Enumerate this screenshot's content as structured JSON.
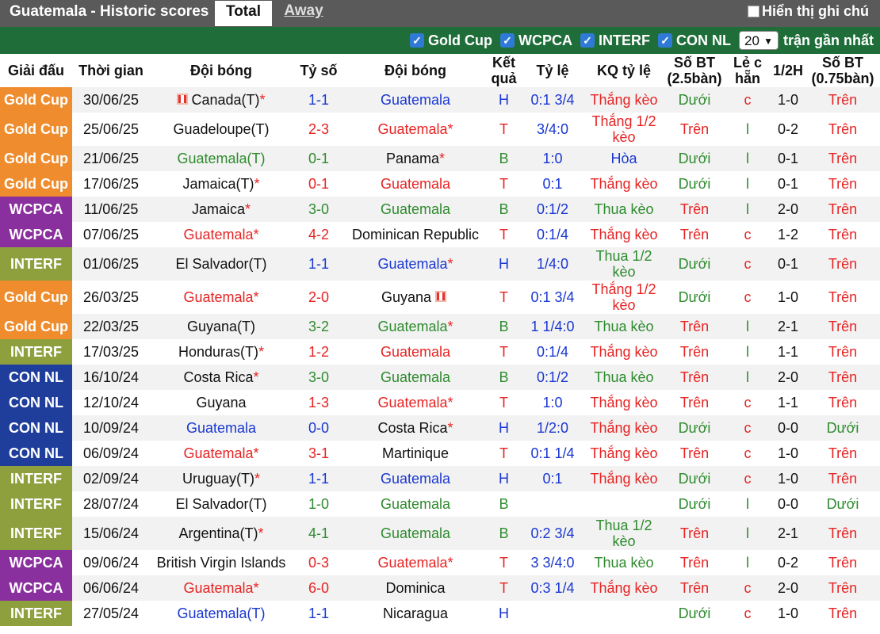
{
  "header": {
    "title": "Guatemala - Historic scores",
    "tabs": [
      "Total",
      "Away"
    ],
    "notes_label": "Hiển thị ghi chú"
  },
  "filters": {
    "checkboxes": [
      "Gold Cup",
      "WCPCA",
      "INTERF",
      "CON NL"
    ],
    "count_value": "20",
    "count_label": "trận gần nhất"
  },
  "columns": [
    "Giải đấu",
    "Thời gian",
    "Đội bóng",
    "Tỷ số",
    "Đội bóng",
    "Kết quả",
    "Tỷ lệ",
    "KQ tỷ lệ",
    "Số BT (2.5bàn)",
    "Lẻ c hẵn",
    "1/2H",
    "Số BT (0.75bàn)"
  ],
  "league_colors": {
    "Gold Cup": "#ef8d2e",
    "WCPCA": "#8a2f9e",
    "INTERF": "#8e9f3e",
    "CON NL": "#1f3e9c"
  },
  "text_colors": {
    "green": "#2e8b2e",
    "red": "#e62424",
    "blue": "#1a37d1"
  },
  "rows": [
    {
      "league": "Gold Cup",
      "date": "30/06/25",
      "home": "Canada(T)",
      "home_star": "*",
      "home_flag": true,
      "home_color": "black",
      "score_home": "1",
      "score_away": "1",
      "score_color": "blue",
      "away": "Guatemala",
      "away_star": "",
      "away_flag": false,
      "away_color": "blue",
      "result": "H",
      "result_color": "blue",
      "odds": "0:1 3/4",
      "odds_result": "Thắng kèo",
      "odds_result_color": "red",
      "ou": "Dưới",
      "ou_color": "green",
      "oe": "c",
      "oe_color": "red",
      "half": "1-0",
      "ou2": "Trên",
      "ou2_color": "red",
      "tall": false
    },
    {
      "league": "Gold Cup",
      "date": "25/06/25",
      "home": "Guadeloupe(T)",
      "home_star": "",
      "home_flag": false,
      "home_color": "black",
      "score_home": "2",
      "score_away": "3",
      "score_color": "red",
      "away": "Guatemala",
      "away_star": "*",
      "away_flag": false,
      "away_color": "red",
      "result": "T",
      "result_color": "red",
      "odds": "3/4:0",
      "odds_result": "Thắng 1/2 kèo",
      "odds_result_color": "red",
      "ou": "Trên",
      "ou_color": "red",
      "oe": "l",
      "oe_color": "green",
      "half": "0-2",
      "ou2": "Trên",
      "ou2_color": "red",
      "tall": true
    },
    {
      "league": "Gold Cup",
      "date": "21/06/25",
      "home": "Guatemala(T)",
      "home_star": "",
      "home_flag": false,
      "home_color": "green",
      "score_home": "0",
      "score_away": "1",
      "score_color": "green",
      "away": "Panama",
      "away_star": "*",
      "away_flag": false,
      "away_color": "black",
      "result": "B",
      "result_color": "green",
      "odds": "1:0",
      "odds_result": "Hòa",
      "odds_result_color": "blue",
      "ou": "Dưới",
      "ou_color": "green",
      "oe": "l",
      "oe_color": "green",
      "half": "0-1",
      "ou2": "Trên",
      "ou2_color": "red",
      "tall": false
    },
    {
      "league": "Gold Cup",
      "date": "17/06/25",
      "home": "Jamaica(T)",
      "home_star": "*",
      "home_flag": false,
      "home_color": "black",
      "score_home": "0",
      "score_away": "1",
      "score_color": "red",
      "away": "Guatemala",
      "away_star": "",
      "away_flag": false,
      "away_color": "red",
      "result": "T",
      "result_color": "red",
      "odds": "0:1",
      "odds_result": "Thắng kèo",
      "odds_result_color": "red",
      "ou": "Dưới",
      "ou_color": "green",
      "oe": "l",
      "oe_color": "green",
      "half": "0-1",
      "ou2": "Trên",
      "ou2_color": "red",
      "tall": false
    },
    {
      "league": "WCPCA",
      "date": "11/06/25",
      "home": "Jamaica",
      "home_star": "*",
      "home_flag": false,
      "home_color": "black",
      "score_home": "3",
      "score_away": "0",
      "score_color": "green",
      "away": "Guatemala",
      "away_star": "",
      "away_flag": false,
      "away_color": "green",
      "result": "B",
      "result_color": "green",
      "odds": "0:1/2",
      "odds_result": "Thua kèo",
      "odds_result_color": "green",
      "ou": "Trên",
      "ou_color": "red",
      "oe": "l",
      "oe_color": "green",
      "half": "2-0",
      "ou2": "Trên",
      "ou2_color": "red",
      "tall": false
    },
    {
      "league": "WCPCA",
      "date": "07/06/25",
      "home": "Guatemala",
      "home_star": "*",
      "home_flag": false,
      "home_color": "red",
      "score_home": "4",
      "score_away": "2",
      "score_color": "red",
      "away": "Dominican Republic",
      "away_star": "",
      "away_flag": false,
      "away_color": "black",
      "result": "T",
      "result_color": "red",
      "odds": "0:1/4",
      "odds_result": "Thắng kèo",
      "odds_result_color": "red",
      "ou": "Trên",
      "ou_color": "red",
      "oe": "c",
      "oe_color": "red",
      "half": "1-2",
      "ou2": "Trên",
      "ou2_color": "red",
      "tall": false
    },
    {
      "league": "INTERF",
      "date": "01/06/25",
      "home": "El Salvador(T)",
      "home_star": "",
      "home_flag": false,
      "home_color": "black",
      "score_home": "1",
      "score_away": "1",
      "score_color": "blue",
      "away": "Guatemala",
      "away_star": "*",
      "away_flag": false,
      "away_color": "blue",
      "result": "H",
      "result_color": "blue",
      "odds": "1/4:0",
      "odds_result": "Thua 1/2 kèo",
      "odds_result_color": "green",
      "ou": "Dưới",
      "ou_color": "green",
      "oe": "c",
      "oe_color": "red",
      "half": "0-1",
      "ou2": "Trên",
      "ou2_color": "red",
      "tall": true
    },
    {
      "league": "Gold Cup",
      "date": "26/03/25",
      "home": "Guatemala",
      "home_star": "*",
      "home_flag": false,
      "home_color": "red",
      "score_home": "2",
      "score_away": "0",
      "score_color": "red",
      "away": "Guyana",
      "away_star": "",
      "away_flag": true,
      "away_color": "black",
      "result": "T",
      "result_color": "red",
      "odds": "0:1 3/4",
      "odds_result": "Thắng 1/2 kèo",
      "odds_result_color": "red",
      "ou": "Dưới",
      "ou_color": "green",
      "oe": "c",
      "oe_color": "red",
      "half": "1-0",
      "ou2": "Trên",
      "ou2_color": "red",
      "tall": true
    },
    {
      "league": "Gold Cup",
      "date": "22/03/25",
      "home": "Guyana(T)",
      "home_star": "",
      "home_flag": false,
      "home_color": "black",
      "score_home": "3",
      "score_away": "2",
      "score_color": "green",
      "away": "Guatemala",
      "away_star": "*",
      "away_flag": false,
      "away_color": "green",
      "result": "B",
      "result_color": "green",
      "odds": "1 1/4:0",
      "odds_result": "Thua kèo",
      "odds_result_color": "green",
      "ou": "Trên",
      "ou_color": "red",
      "oe": "l",
      "oe_color": "green",
      "half": "2-1",
      "ou2": "Trên",
      "ou2_color": "red",
      "tall": false
    },
    {
      "league": "INTERF",
      "date": "17/03/25",
      "home": "Honduras(T)",
      "home_star": "*",
      "home_flag": false,
      "home_color": "black",
      "score_home": "1",
      "score_away": "2",
      "score_color": "red",
      "away": "Guatemala",
      "away_star": "",
      "away_flag": false,
      "away_color": "red",
      "result": "T",
      "result_color": "red",
      "odds": "0:1/4",
      "odds_result": "Thắng kèo",
      "odds_result_color": "red",
      "ou": "Trên",
      "ou_color": "red",
      "oe": "l",
      "oe_color": "green",
      "half": "1-1",
      "ou2": "Trên",
      "ou2_color": "red",
      "tall": false
    },
    {
      "league": "CON NL",
      "date": "16/10/24",
      "home": "Costa Rica",
      "home_star": "*",
      "home_flag": false,
      "home_color": "black",
      "score_home": "3",
      "score_away": "0",
      "score_color": "green",
      "away": "Guatemala",
      "away_star": "",
      "away_flag": false,
      "away_color": "green",
      "result": "B",
      "result_color": "green",
      "odds": "0:1/2",
      "odds_result": "Thua kèo",
      "odds_result_color": "green",
      "ou": "Trên",
      "ou_color": "red",
      "oe": "l",
      "oe_color": "green",
      "half": "2-0",
      "ou2": "Trên",
      "ou2_color": "red",
      "tall": false
    },
    {
      "league": "CON NL",
      "date": "12/10/24",
      "home": "Guyana",
      "home_star": "",
      "home_flag": false,
      "home_color": "black",
      "score_home": "1",
      "score_away": "3",
      "score_color": "red",
      "away": "Guatemala",
      "away_star": "*",
      "away_flag": false,
      "away_color": "red",
      "result": "T",
      "result_color": "red",
      "odds": "1:0",
      "odds_result": "Thắng kèo",
      "odds_result_color": "red",
      "ou": "Trên",
      "ou_color": "red",
      "oe": "c",
      "oe_color": "red",
      "half": "1-1",
      "ou2": "Trên",
      "ou2_color": "red",
      "tall": false
    },
    {
      "league": "CON NL",
      "date": "10/09/24",
      "home": "Guatemala",
      "home_star": "",
      "home_flag": false,
      "home_color": "blue",
      "score_home": "0",
      "score_away": "0",
      "score_color": "blue",
      "away": "Costa Rica",
      "away_star": "*",
      "away_flag": false,
      "away_color": "black",
      "result": "H",
      "result_color": "blue",
      "odds": "1/2:0",
      "odds_result": "Thắng kèo",
      "odds_result_color": "red",
      "ou": "Dưới",
      "ou_color": "green",
      "oe": "c",
      "oe_color": "red",
      "half": "0-0",
      "ou2": "Dưới",
      "ou2_color": "green",
      "tall": false
    },
    {
      "league": "CON NL",
      "date": "06/09/24",
      "home": "Guatemala",
      "home_star": "*",
      "home_flag": false,
      "home_color": "red",
      "score_home": "3",
      "score_away": "1",
      "score_color": "red",
      "away": "Martinique",
      "away_star": "",
      "away_flag": false,
      "away_color": "black",
      "result": "T",
      "result_color": "red",
      "odds": "0:1 1/4",
      "odds_result": "Thắng kèo",
      "odds_result_color": "red",
      "ou": "Trên",
      "ou_color": "red",
      "oe": "c",
      "oe_color": "red",
      "half": "1-0",
      "ou2": "Trên",
      "ou2_color": "red",
      "tall": false
    },
    {
      "league": "INTERF",
      "date": "02/09/24",
      "home": "Uruguay(T)",
      "home_star": "*",
      "home_flag": false,
      "home_color": "black",
      "score_home": "1",
      "score_away": "1",
      "score_color": "blue",
      "away": "Guatemala",
      "away_star": "",
      "away_flag": false,
      "away_color": "blue",
      "result": "H",
      "result_color": "blue",
      "odds": "0:1",
      "odds_result": "Thắng kèo",
      "odds_result_color": "red",
      "ou": "Dưới",
      "ou_color": "green",
      "oe": "c",
      "oe_color": "red",
      "half": "1-0",
      "ou2": "Trên",
      "ou2_color": "red",
      "tall": false
    },
    {
      "league": "INTERF",
      "date": "28/07/24",
      "home": "El Salvador(T)",
      "home_star": "",
      "home_flag": false,
      "home_color": "black",
      "score_home": "1",
      "score_away": "0",
      "score_color": "green",
      "away": "Guatemala",
      "away_star": "",
      "away_flag": false,
      "away_color": "green",
      "result": "B",
      "result_color": "green",
      "odds": "",
      "odds_result": "",
      "odds_result_color": "red",
      "ou": "Dưới",
      "ou_color": "green",
      "oe": "l",
      "oe_color": "green",
      "half": "0-0",
      "ou2": "Dưới",
      "ou2_color": "green",
      "tall": false
    },
    {
      "league": "INTERF",
      "date": "15/06/24",
      "home": "Argentina(T)",
      "home_star": "*",
      "home_flag": false,
      "home_color": "black",
      "score_home": "4",
      "score_away": "1",
      "score_color": "green",
      "away": "Guatemala",
      "away_star": "",
      "away_flag": false,
      "away_color": "green",
      "result": "B",
      "result_color": "green",
      "odds": "0:2 3/4",
      "odds_result": "Thua 1/2 kèo",
      "odds_result_color": "green",
      "ou": "Trên",
      "ou_color": "red",
      "oe": "l",
      "oe_color": "green",
      "half": "2-1",
      "ou2": "Trên",
      "ou2_color": "red",
      "tall": true
    },
    {
      "league": "WCPCA",
      "date": "09/06/24",
      "home": "British Virgin Islands",
      "home_star": "",
      "home_flag": false,
      "home_color": "black",
      "score_home": "0",
      "score_away": "3",
      "score_color": "red",
      "away": "Guatemala",
      "away_star": "*",
      "away_flag": false,
      "away_color": "red",
      "result": "T",
      "result_color": "red",
      "odds": "3 3/4:0",
      "odds_result": "Thua kèo",
      "odds_result_color": "green",
      "ou": "Trên",
      "ou_color": "red",
      "oe": "l",
      "oe_color": "green",
      "half": "0-2",
      "ou2": "Trên",
      "ou2_color": "red",
      "tall": false
    },
    {
      "league": "WCPCA",
      "date": "06/06/24",
      "home": "Guatemala",
      "home_star": "*",
      "home_flag": false,
      "home_color": "red",
      "score_home": "6",
      "score_away": "0",
      "score_color": "red",
      "away": "Dominica",
      "away_star": "",
      "away_flag": false,
      "away_color": "black",
      "result": "T",
      "result_color": "red",
      "odds": "0:3 1/4",
      "odds_result": "Thắng kèo",
      "odds_result_color": "red",
      "ou": "Trên",
      "ou_color": "red",
      "oe": "c",
      "oe_color": "red",
      "half": "2-0",
      "ou2": "Trên",
      "ou2_color": "red",
      "tall": false
    },
    {
      "league": "INTERF",
      "date": "27/05/24",
      "home": "Guatemala(T)",
      "home_star": "",
      "home_flag": false,
      "home_color": "blue",
      "score_home": "1",
      "score_away": "1",
      "score_color": "blue",
      "away": "Nicaragua",
      "away_star": "",
      "away_flag": false,
      "away_color": "black",
      "result": "H",
      "result_color": "blue",
      "odds": "",
      "odds_result": "",
      "odds_result_color": "red",
      "ou": "Dưới",
      "ou_color": "green",
      "oe": "c",
      "oe_color": "red",
      "half": "1-0",
      "ou2": "Trên",
      "ou2_color": "red",
      "tall": false
    }
  ]
}
